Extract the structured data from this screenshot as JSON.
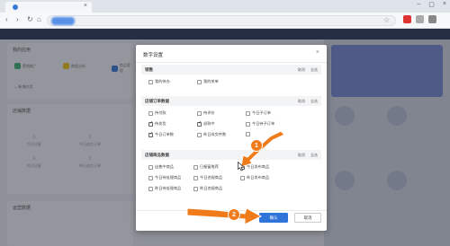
{
  "modal": {
    "title": "数字设置",
    "close_icon": "×",
    "confirm_label": "确认",
    "cancel_label": "取消"
  },
  "sections": {
    "sales": {
      "label": "销售",
      "action_cancel": "取消",
      "action_all": "全选",
      "options": [
        {
          "label": "我的待办",
          "checked": false
        },
        {
          "label": "我的关单",
          "checked": false
        }
      ]
    },
    "orders": {
      "label": "店铺订单数据",
      "action_cancel": "取消",
      "action_all": "全选",
      "options": [
        {
          "label": "待付款",
          "checked": false
        },
        {
          "label": "待评价",
          "checked": false
        },
        {
          "label": "今日子订单",
          "checked": false
        },
        {
          "label": "待发货",
          "checked": true
        },
        {
          "label": "退款中",
          "checked": true
        },
        {
          "label": "今日待子订单",
          "checked": false
        },
        {
          "label": "今日订单数",
          "checked": true
        },
        {
          "label": "昨日成交件数",
          "checked": false
        }
      ]
    },
    "products": {
      "label": "店铺商品数据",
      "action_cancel": "取消",
      "action_all": "全选",
      "options": [
        {
          "label": "出售中商品",
          "checked": false
        },
        {
          "label": "已橱窗推荐",
          "checked": false
        },
        {
          "label": "今日发布商品",
          "checked": true
        },
        {
          "label": "今日待处理商品",
          "checked": false
        },
        {
          "label": "今日违规商品",
          "checked": false
        },
        {
          "label": "昨日发布商品",
          "checked": false
        },
        {
          "label": "昨日待处理商品",
          "checked": false
        },
        {
          "label": "昨日违规商品",
          "checked": false
        }
      ]
    }
  },
  "background": {
    "my_apps_title": "我的应用",
    "apps": [
      "营销推广",
      "数据分析",
      "商品管理"
    ],
    "add_app_label": "新增应用",
    "store_data_title": "店铺数据",
    "stats": [
      "今日访客",
      "今日成交订单",
      "昨日访客",
      "昨日成交订单"
    ],
    "stat_values": [
      "0",
      "0",
      "0",
      "0"
    ],
    "bottom_title": "运营数据"
  },
  "annotations": {
    "marker_1": "1",
    "marker_2": "2"
  },
  "colors": {
    "accent": "#2f74d8",
    "annotation": "#f07b1b",
    "header": "#2b3a55"
  }
}
